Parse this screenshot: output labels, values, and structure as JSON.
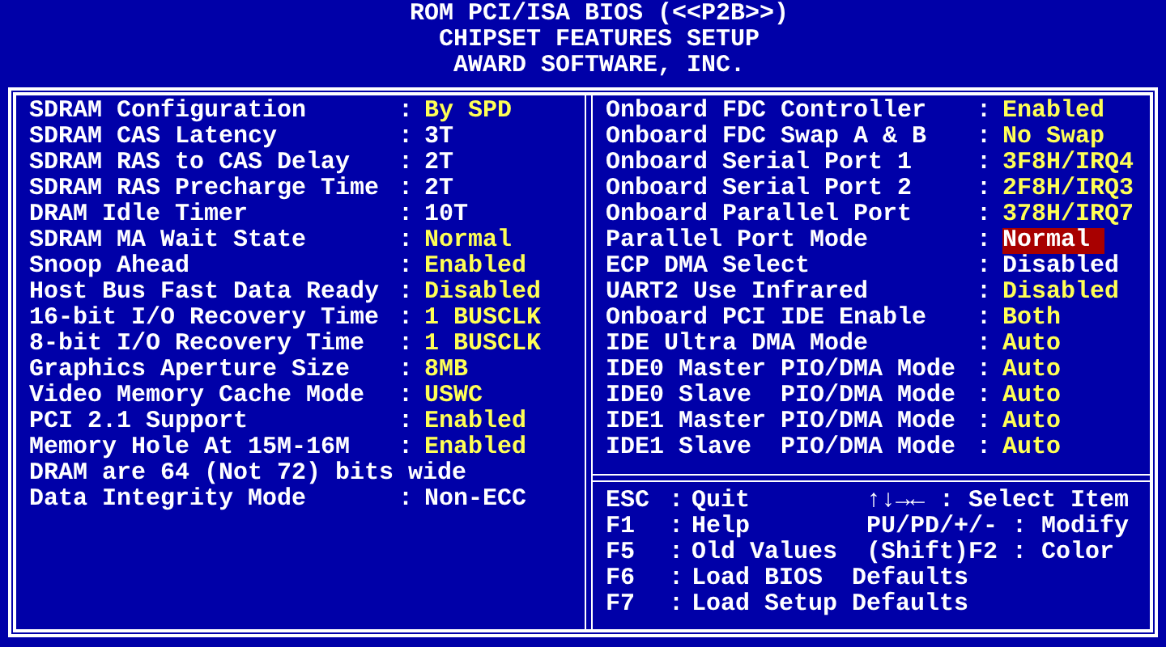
{
  "header": [
    "ROM PCI/ISA BIOS (<<P2B>>)",
    "CHIPSET FEATURES SETUP",
    "AWARD SOFTWARE, INC."
  ],
  "left_items": [
    {
      "kind": "setting",
      "label": "SDRAM Configuration",
      "separator": ":",
      "value": "By SPD",
      "editable": true,
      "selected": false
    },
    {
      "kind": "setting",
      "label": "SDRAM CAS Latency",
      "separator": ":",
      "value": "3T",
      "editable": false,
      "selected": false
    },
    {
      "kind": "setting",
      "label": "SDRAM RAS to CAS Delay",
      "separator": ":",
      "value": "2T",
      "editable": false,
      "selected": false
    },
    {
      "kind": "setting",
      "label": "SDRAM RAS Precharge Time",
      "separator": ":",
      "value": "2T",
      "editable": false,
      "selected": false
    },
    {
      "kind": "setting",
      "label": "DRAM Idle Timer",
      "separator": ":",
      "value": "10T",
      "editable": false,
      "selected": false
    },
    {
      "kind": "setting",
      "label": "SDRAM MA Wait State",
      "separator": ":",
      "value": "Normal",
      "editable": true,
      "selected": false
    },
    {
      "kind": "setting",
      "label": "Snoop Ahead",
      "separator": ":",
      "value": "Enabled",
      "editable": true,
      "selected": false
    },
    {
      "kind": "setting",
      "label": "Host Bus Fast Data Ready",
      "separator": ":",
      "value": "Disabled",
      "editable": true,
      "selected": false
    },
    {
      "kind": "setting",
      "label": "16-bit I/O Recovery Time",
      "separator": ":",
      "value": "1 BUSCLK",
      "editable": true,
      "selected": false
    },
    {
      "kind": "setting",
      "label": "8-bit I/O Recovery Time",
      "separator": ":",
      "value": "1 BUSCLK",
      "editable": true,
      "selected": false
    },
    {
      "kind": "setting",
      "label": "Graphics Aperture Size",
      "separator": ":",
      "value": "8MB",
      "editable": true,
      "selected": false
    },
    {
      "kind": "setting",
      "label": "Video Memory Cache Mode",
      "separator": ":",
      "value": "USWC",
      "editable": true,
      "selected": false
    },
    {
      "kind": "setting",
      "label": "PCI 2.1 Support",
      "separator": ":",
      "value": "Enabled",
      "editable": true,
      "selected": false
    },
    {
      "kind": "setting",
      "label": "Memory Hole At 15M-16M",
      "separator": ":",
      "value": "Enabled",
      "editable": true,
      "selected": false
    },
    {
      "kind": "note",
      "label": "DRAM are 64 (Not 72) bits wide"
    },
    {
      "kind": "setting",
      "label": "Data Integrity Mode",
      "separator": ":",
      "value": "Non-ECC",
      "editable": false,
      "selected": false
    }
  ],
  "right_items": [
    {
      "kind": "setting",
      "label": "Onboard FDC Controller",
      "separator": ":",
      "value": "Enabled",
      "editable": true,
      "selected": false
    },
    {
      "kind": "setting",
      "label": "Onboard FDC Swap A & B",
      "separator": ":",
      "value": "No Swap",
      "editable": true,
      "selected": false
    },
    {
      "kind": "setting",
      "label": "Onboard Serial Port 1",
      "separator": ":",
      "value": "3F8H/IRQ4",
      "editable": true,
      "selected": false
    },
    {
      "kind": "setting",
      "label": "Onboard Serial Port 2",
      "separator": ":",
      "value": "2F8H/IRQ3",
      "editable": true,
      "selected": false
    },
    {
      "kind": "setting",
      "label": "Onboard Parallel Port",
      "separator": ":",
      "value": "378H/IRQ7",
      "editable": true,
      "selected": false
    },
    {
      "kind": "setting",
      "label": "Parallel Port Mode",
      "separator": ":",
      "value": "Normal",
      "editable": true,
      "selected": true
    },
    {
      "kind": "setting",
      "label": "ECP DMA Select",
      "separator": ":",
      "value": "Disabled",
      "editable": false,
      "selected": false
    },
    {
      "kind": "setting",
      "label": "UART2 Use Infrared",
      "separator": ":",
      "value": "Disabled",
      "editable": true,
      "selected": false
    },
    {
      "kind": "setting",
      "label": "Onboard PCI IDE Enable",
      "separator": ":",
      "value": "Both",
      "editable": true,
      "selected": false
    },
    {
      "kind": "setting",
      "label": "IDE Ultra DMA Mode",
      "separator": ":",
      "value": "Auto",
      "editable": true,
      "selected": false
    },
    {
      "kind": "setting",
      "label": "IDE0 Master PIO/DMA Mode",
      "separator": ":",
      "value": "Auto",
      "editable": true,
      "selected": false
    },
    {
      "kind": "setting",
      "label": "IDE0 Slave  PIO/DMA Mode",
      "separator": ":",
      "value": "Auto",
      "editable": true,
      "selected": false
    },
    {
      "kind": "setting",
      "label": "IDE1 Master PIO/DMA Mode",
      "separator": ":",
      "value": "Auto",
      "editable": true,
      "selected": false
    },
    {
      "kind": "setting",
      "label": "IDE1 Slave  PIO/DMA Mode",
      "separator": ":",
      "value": "Auto",
      "editable": true,
      "selected": false
    }
  ],
  "help": [
    {
      "key": "ESC",
      "separator": ":",
      "action": "Quit",
      "key2": "↑↓→←",
      "separator2": ":",
      "action2": "Select Item"
    },
    {
      "key": "F1",
      "separator": ":",
      "action": "Help",
      "key2": "PU/PD/+/-",
      "separator2": ":",
      "action2": "Modify"
    },
    {
      "key": "F5",
      "separator": ":",
      "action": "Old Values",
      "key2": "(Shift)F2",
      "separator2": ":",
      "action2": "Color"
    },
    {
      "key": "F6",
      "separator": ":",
      "action": "Load BIOS  Defaults"
    },
    {
      "key": "F7",
      "separator": ":",
      "action": "Load Setup Defaults"
    }
  ]
}
